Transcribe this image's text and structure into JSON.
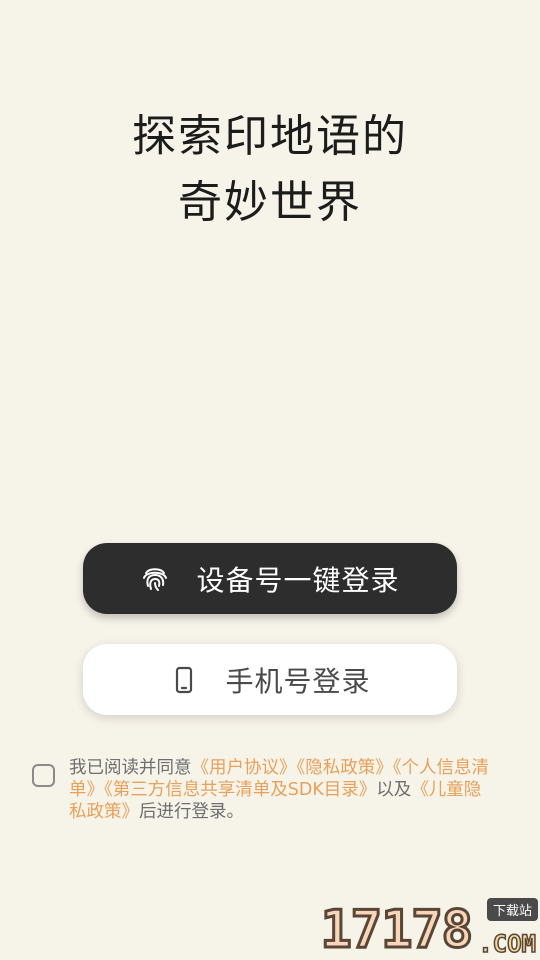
{
  "headline": {
    "line1": "探索印地语的",
    "line2": "奇妙世界"
  },
  "buttons": {
    "device_login": {
      "label": "设备号一键登录",
      "icon": "fingerprint-icon"
    },
    "phone_login": {
      "label": "手机号登录",
      "icon": "smartphone-icon"
    }
  },
  "agreement": {
    "checked": false,
    "prefix": "我已阅读并同意",
    "user_agreement": "《用户协议》",
    "privacy_policy": "《隐私政策》",
    "personal_info_list": "《个人信息清单》",
    "third_party_list": "《第三方信息共享清单及SDK目录》",
    "connector": "以及",
    "children_privacy": "《儿童隐私政策》",
    "suffix": "后进行登录。"
  },
  "watermark": {
    "number": "17178",
    "domain": ".COM",
    "badge": "下载站"
  },
  "colors": {
    "background": "#f6f3e9",
    "primary_button": "#2d2d2d",
    "secondary_button": "#ffffff",
    "link": "#e7a15a"
  }
}
